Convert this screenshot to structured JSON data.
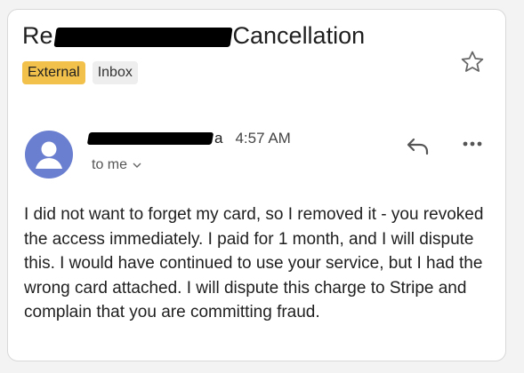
{
  "email": {
    "subject_prefix": "Re",
    "subject_suffix": "Cancellation",
    "labels": [
      {
        "text": "External",
        "color": "#f2c14b"
      },
      {
        "text": "Inbox",
        "color": "#eeeeee"
      }
    ],
    "sender_tail": "a",
    "time": "4:57 AM",
    "recipient": "to me",
    "body": "I did not want to forget my card, so I removed it - you revoked the access immediately. I paid for 1 month, and I will dispute this. I would have continued to use your service, but I had the wrong card attached. I will dispute this charge to Stripe and complain that you are committing fraud."
  },
  "icons": {
    "star": "star-icon",
    "avatar": "person-avatar-icon",
    "reply": "reply-icon",
    "more": "more-options-icon",
    "chevron": "chevron-down-icon"
  },
  "colors": {
    "avatar_bg": "#6b7fd0",
    "external_label": "#f2c14b"
  }
}
